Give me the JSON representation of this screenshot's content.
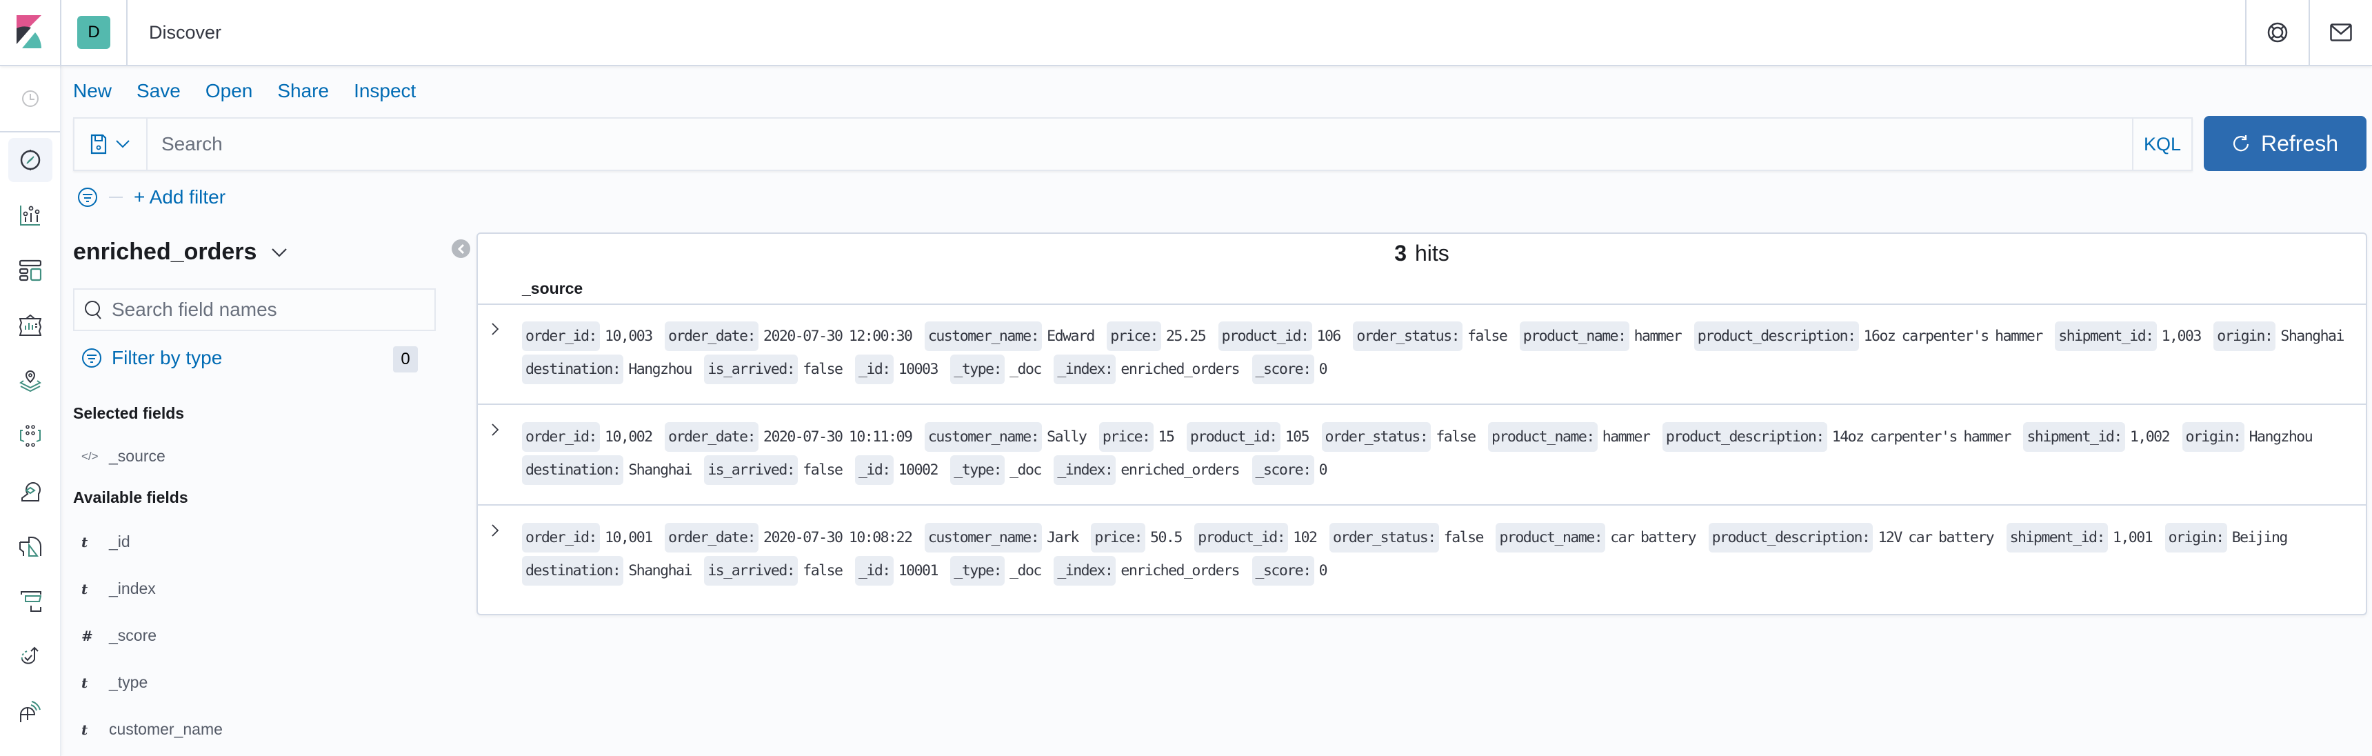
{
  "header": {
    "space_initial": "D",
    "page_title": "Discover",
    "colors": {
      "space_avatar": "#54b9ae",
      "accent": "#006bb4",
      "refresh_button": "#2c6bb0"
    }
  },
  "leftnav": {
    "items": [
      {
        "name": "recently-viewed",
        "icon": "clock-icon"
      },
      {
        "name": "discover",
        "icon": "compass-icon",
        "active": true
      },
      {
        "name": "visualize",
        "icon": "visualize-chart-icon"
      },
      {
        "name": "dashboard",
        "icon": "dashboard-icon"
      },
      {
        "name": "canvas",
        "icon": "canvas-icon"
      },
      {
        "name": "maps",
        "icon": "maps-icon"
      },
      {
        "name": "machine-learning",
        "icon": "ml-icon"
      },
      {
        "name": "siem",
        "icon": "siem-icon"
      },
      {
        "name": "logs",
        "icon": "logs-icon"
      },
      {
        "name": "apm",
        "icon": "apm-icon"
      },
      {
        "name": "uptime",
        "icon": "uptime-icon"
      },
      {
        "name": "metrics",
        "icon": "metrics-icon"
      }
    ]
  },
  "topmenu": {
    "new": "New",
    "save": "Save",
    "open": "Open",
    "share": "Share",
    "inspect": "Inspect"
  },
  "querybar": {
    "placeholder": "Search",
    "value": "",
    "language": "KQL",
    "refresh_label": "Refresh"
  },
  "filters": {
    "add_filter_label": "+ Add filter"
  },
  "sidebar": {
    "index_pattern": "enriched_orders",
    "search_placeholder": "Search field names",
    "filter_by_type_label": "Filter by type",
    "filter_count": "0",
    "selected_fields_title": "Selected fields",
    "selected_fields": [
      {
        "type": "</>",
        "name": "_source"
      }
    ],
    "available_fields_title": "Available fields",
    "available_fields": [
      {
        "type": "t",
        "name": "_id"
      },
      {
        "type": "t",
        "name": "_index"
      },
      {
        "type": "#",
        "name": "_score"
      },
      {
        "type": "t",
        "name": "_type"
      },
      {
        "type": "t",
        "name": "customer_name"
      }
    ]
  },
  "results": {
    "hits_count": "3",
    "hits_label": "hits",
    "column_header": "_source",
    "documents": [
      [
        [
          "order_id:",
          "10,003"
        ],
        [
          "order_date:",
          "2020-07-30 12:00:30"
        ],
        [
          "customer_name:",
          "Edward"
        ],
        [
          "price:",
          "25.25"
        ],
        [
          "product_id:",
          "106"
        ],
        [
          "order_status:",
          "false"
        ],
        [
          "product_name:",
          "hammer"
        ],
        [
          "product_description:",
          "16oz carpenter's hammer"
        ],
        [
          "shipment_id:",
          "1,003"
        ],
        [
          "origin:",
          "Shanghai"
        ],
        [
          "destination:",
          "Hangzhou"
        ],
        [
          "is_arrived:",
          "false"
        ],
        [
          "_id:",
          "10003"
        ],
        [
          "_type:",
          "_doc"
        ],
        [
          "_index:",
          "enriched_orders"
        ],
        [
          "_score:",
          "0"
        ]
      ],
      [
        [
          "order_id:",
          "10,002"
        ],
        [
          "order_date:",
          "2020-07-30 10:11:09"
        ],
        [
          "customer_name:",
          "Sally"
        ],
        [
          "price:",
          "15"
        ],
        [
          "product_id:",
          "105"
        ],
        [
          "order_status:",
          "false"
        ],
        [
          "product_name:",
          "hammer"
        ],
        [
          "product_description:",
          "14oz carpenter's hammer"
        ],
        [
          "shipment_id:",
          "1,002"
        ],
        [
          "origin:",
          "Hangzhou"
        ],
        [
          "destination:",
          "Shanghai"
        ],
        [
          "is_arrived:",
          "false"
        ],
        [
          "_id:",
          "10002"
        ],
        [
          "_type:",
          "_doc"
        ],
        [
          "_index:",
          "enriched_orders"
        ],
        [
          "_score:",
          "0"
        ]
      ],
      [
        [
          "order_id:",
          "10,001"
        ],
        [
          "order_date:",
          "2020-07-30 10:08:22"
        ],
        [
          "customer_name:",
          "Jark"
        ],
        [
          "price:",
          "50.5"
        ],
        [
          "product_id:",
          "102"
        ],
        [
          "order_status:",
          "false"
        ],
        [
          "product_name:",
          "car battery"
        ],
        [
          "product_description:",
          "12V car battery"
        ],
        [
          "shipment_id:",
          "1,001"
        ],
        [
          "origin:",
          "Beijing"
        ],
        [
          "destination:",
          "Shanghai"
        ],
        [
          "is_arrived:",
          "false"
        ],
        [
          "_id:",
          "10001"
        ],
        [
          "_type:",
          "_doc"
        ],
        [
          "_index:",
          "enriched_orders"
        ],
        [
          "_score:",
          "0"
        ]
      ]
    ]
  }
}
